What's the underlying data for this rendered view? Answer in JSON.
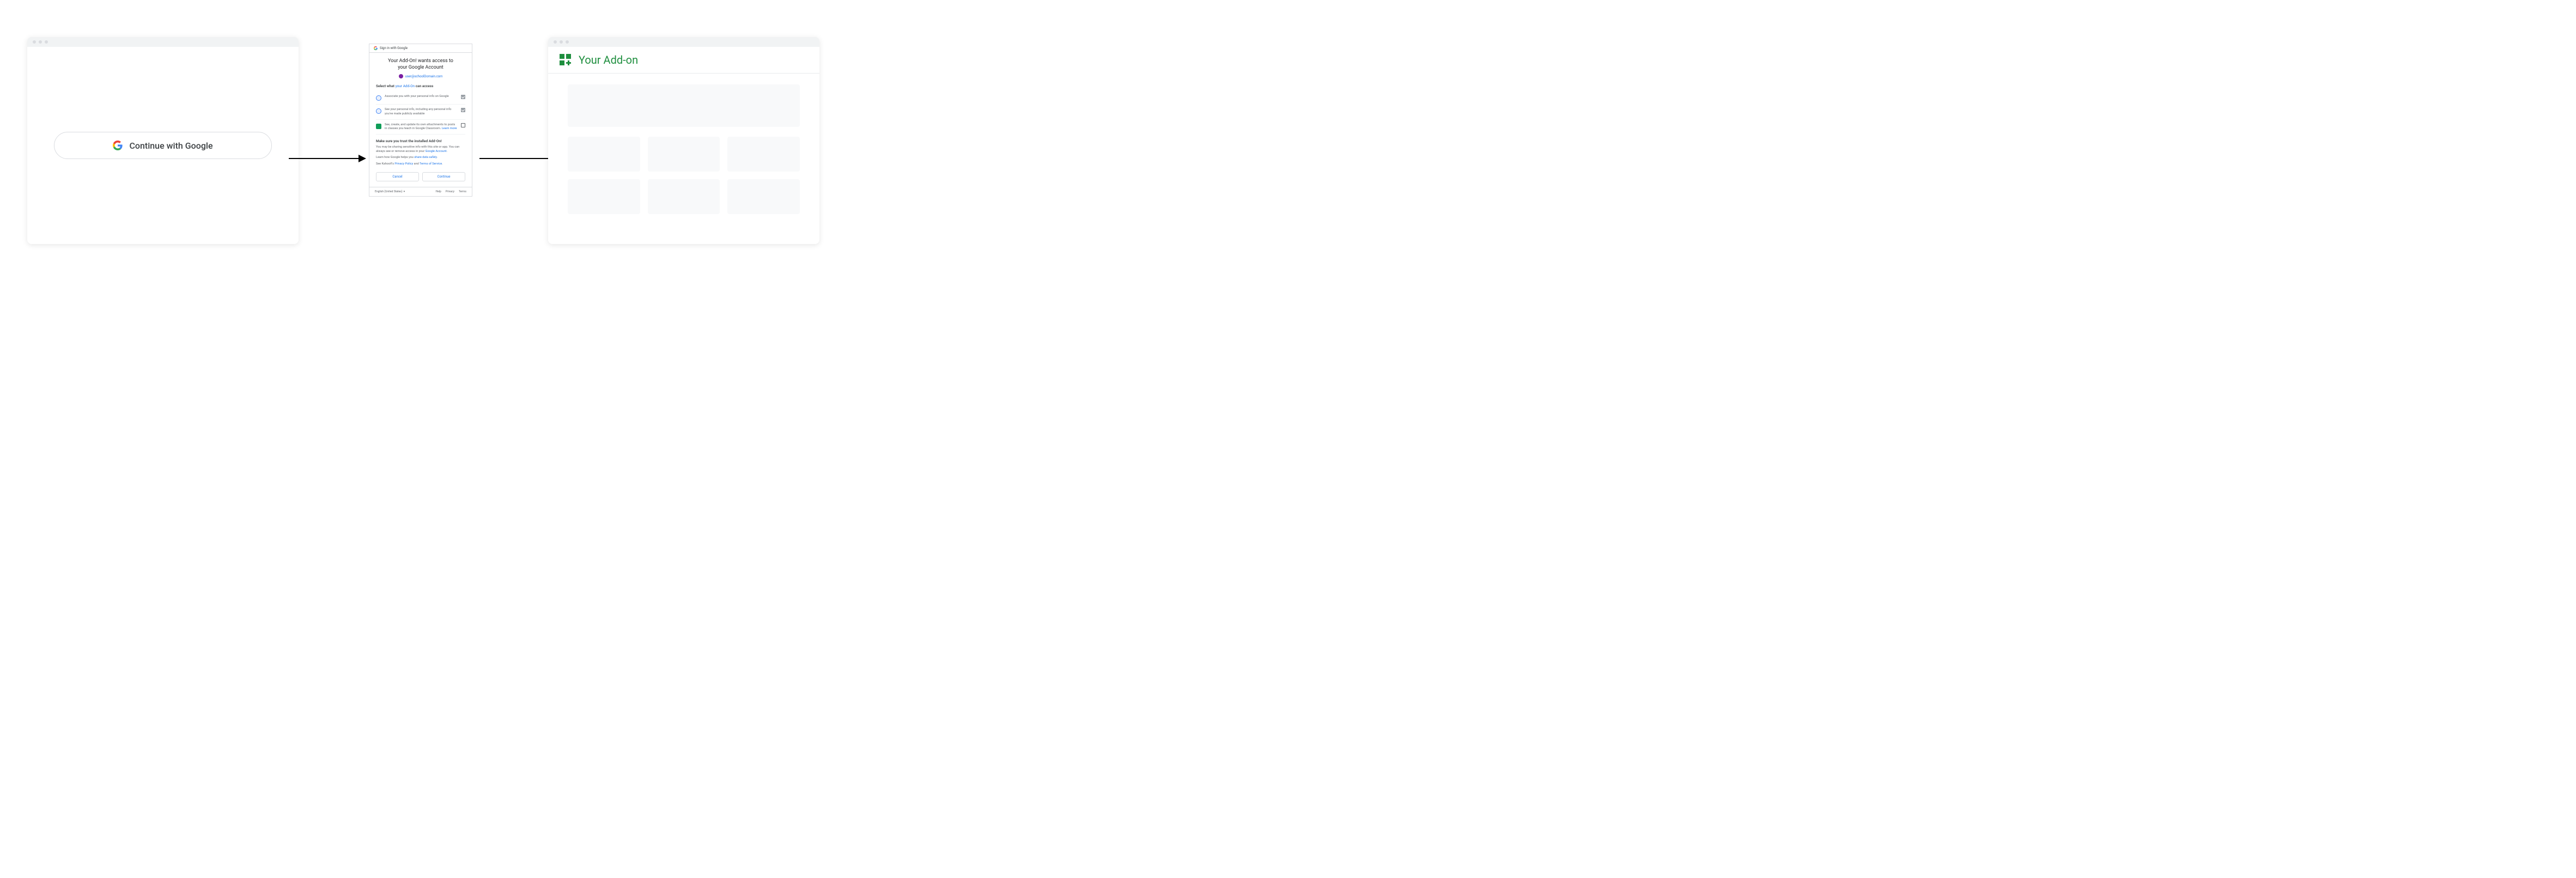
{
  "panel1": {
    "continue_button_label": "Continue with Google"
  },
  "panel2": {
    "header_label": "Sign in with Google",
    "title_line1": "Your Add-On! wants access to",
    "title_line2": "your Google Account",
    "account_email": "user@schoolDomain.com",
    "select_prefix": "Select what ",
    "select_link": "your Add-On",
    "select_suffix": " can access",
    "scopes": [
      {
        "text": "Associate you with your personal info on Google",
        "checked": true,
        "icon": "profile"
      },
      {
        "text": "See your personal info, including any personal info you've made publicly available",
        "checked": true,
        "icon": "profile"
      },
      {
        "text_prefix": "See, create, and update its own attachments to posts in classes you teach in Google Classroom. ",
        "learn_more": "Learn more",
        "checked": false,
        "icon": "drive"
      }
    ],
    "trust_title": "Make sure you trust the installed Add-On!",
    "trust_p1_prefix": "You may be sharing sensitive info with this site or app. You can always see or remove access in your ",
    "trust_p1_link": "Google Account",
    "trust_p1_suffix": ".",
    "trust_p2_prefix": "Learn how Google helps you ",
    "trust_p2_link": "share data safely",
    "trust_p2_suffix": ".",
    "trust_p3_prefix": "See Kahoot!'s ",
    "trust_p3_link1": "Privacy Policy",
    "trust_p3_mid": " and ",
    "trust_p3_link2": "Terms of Service",
    "trust_p3_suffix": ".",
    "cancel_label": "Cancel",
    "continue_label": "Continue",
    "footer_language": "English (United States)",
    "footer_dropdown_glyph": "▾",
    "footer_links": {
      "help": "Help",
      "privacy": "Privacy",
      "terms": "Terms"
    }
  },
  "panel3": {
    "app_title": "Your Add-on"
  },
  "colors": {
    "google_blue": "#4285f4",
    "google_red": "#ea4335",
    "google_yellow": "#fbbc05",
    "google_green": "#34a853",
    "brand_green": "#1e8e3e",
    "link": "#1a73e8",
    "placeholder": "#f8f9fa"
  }
}
